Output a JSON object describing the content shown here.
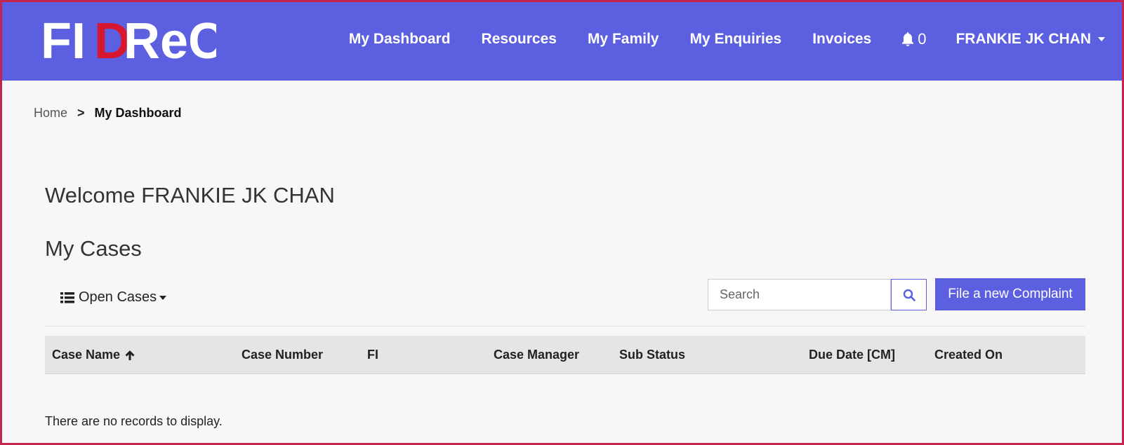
{
  "brand": {
    "logo_text_1": "FI",
    "logo_text_2": "D",
    "logo_text_3": "ReC",
    "logo_white": "#ffffff",
    "logo_red": "#d7172f"
  },
  "colors": {
    "nav_bg": "#5b5fe0",
    "accent": "#5b5fe0",
    "frame_border": "#c2264f",
    "page_bg": "#f7f7f7"
  },
  "nav": {
    "items": [
      {
        "label": "My Dashboard"
      },
      {
        "label": "Resources"
      },
      {
        "label": "My Family"
      },
      {
        "label": "My Enquiries"
      },
      {
        "label": "Invoices"
      }
    ],
    "notifications": {
      "icon": "bell-icon",
      "count": "0"
    },
    "user": {
      "name": "FRANKIE JK CHAN",
      "icon": "caret-down-icon"
    }
  },
  "breadcrumb": {
    "home": "Home",
    "separator": ">",
    "current": "My Dashboard"
  },
  "main": {
    "welcome": "Welcome FRANKIE JK CHAN",
    "cases_title": "My Cases",
    "view_selector": {
      "label": "Open Cases",
      "icon": "list-icon"
    },
    "search": {
      "placeholder": "Search",
      "value": "",
      "icon": "search-icon"
    },
    "new_complaint_label": "File a new Complaint"
  },
  "table": {
    "columns": [
      {
        "label": "Case Name",
        "sort": "ascending"
      },
      {
        "label": "Case Number"
      },
      {
        "label": "FI"
      },
      {
        "label": "Case Manager"
      },
      {
        "label": "Sub Status"
      },
      {
        "label": "Due Date [CM]"
      },
      {
        "label": "Created On"
      }
    ],
    "rows": [],
    "empty_message": "There are no records to display."
  }
}
